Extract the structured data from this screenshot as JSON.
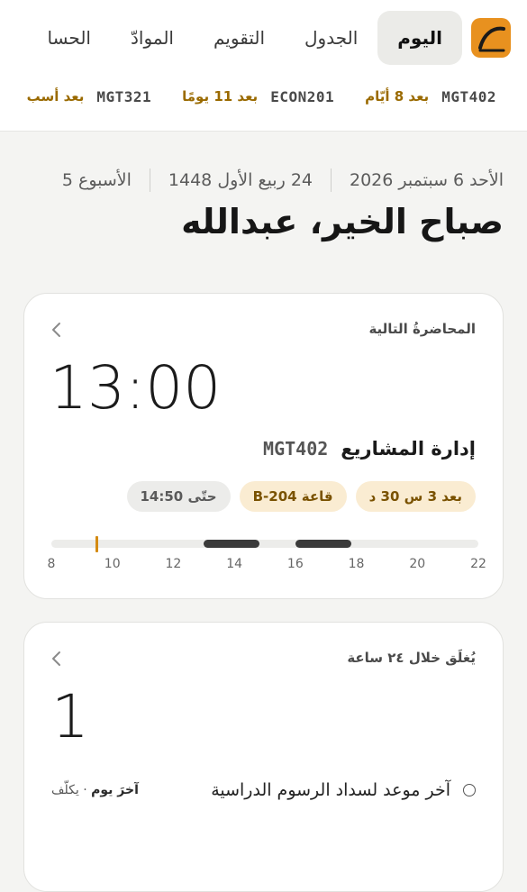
{
  "nav": {
    "logo_icon": "app-logo-icon",
    "tabs": [
      {
        "label": "اليوم",
        "active": true
      },
      {
        "label": "الجدول",
        "active": false
      },
      {
        "label": "التقويم",
        "active": false
      },
      {
        "label": "الموادّ",
        "active": false
      },
      {
        "label": "الحسا",
        "active": false
      }
    ]
  },
  "deadlines": [
    {
      "course": "MGT402",
      "due": "بعد 8 أيّام"
    },
    {
      "course": "ECON201",
      "due": "بعد 11 يومًا"
    },
    {
      "course": "MGT321",
      "due": "بعد أسب"
    }
  ],
  "date": {
    "gregorian": "الأحد 6 سبتمبر 2026",
    "hijri": "24 ربيع الأول 1448",
    "week": "الأسبوع 5"
  },
  "greeting": "صباح الخير، عبدالله",
  "next_lecture": {
    "label": "المحاضرةُ التالية",
    "time": "13:00",
    "course_code": "MGT402",
    "course_name": "إدارة المشاريع",
    "chips": {
      "starts_in": "بعد 3 س 30 د",
      "room": "قاعة B-204",
      "until": "حتّى 14:50"
    },
    "timeline": {
      "ticks": [
        "8",
        "10",
        "12",
        "14",
        "16",
        "18",
        "20",
        "22"
      ],
      "range": [
        8,
        22
      ],
      "now_hour": 9.5,
      "blocks": [
        [
          13.0,
          14.83
        ],
        [
          16.0,
          17.83
        ]
      ],
      "accent_color": "#d48a12"
    }
  },
  "closing_soon": {
    "label": "يُغلَق خلال ٢٤ ساعة",
    "count": "1",
    "task": {
      "title": "آخر موعد لسداد الرسوم الدراسية",
      "day": "آخرَ يوم",
      "note": " · يكلّف"
    }
  },
  "colors": {
    "accent": "#e8911f",
    "warm_text": "#9a6a00"
  }
}
